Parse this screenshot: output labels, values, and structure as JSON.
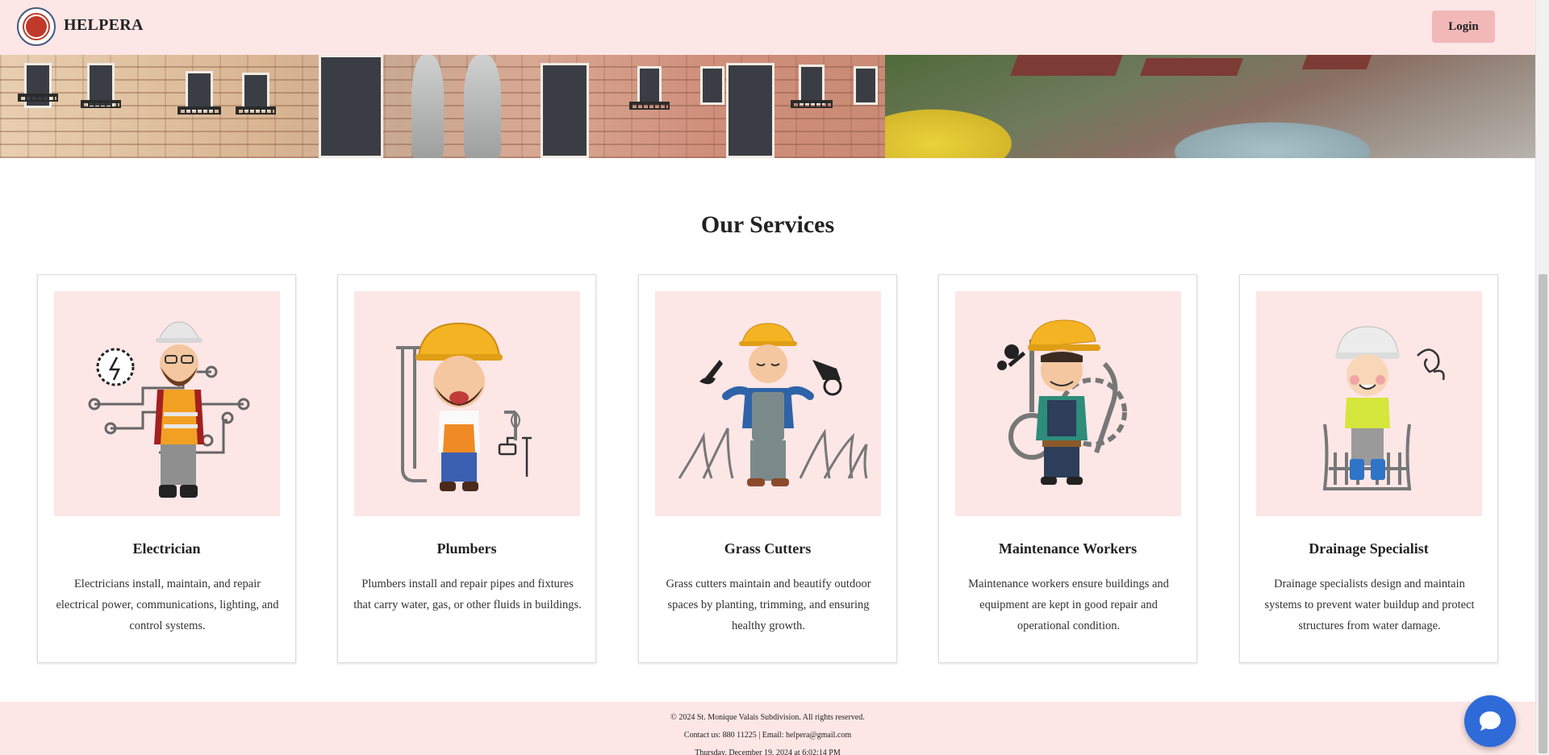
{
  "header": {
    "brand": "HELPERA",
    "login_label": "Login"
  },
  "services": {
    "title": "Our Services",
    "items": [
      {
        "title": "Electrician",
        "description": "Electricians install, maintain, and repair electrical power, communications, lighting, and control systems.",
        "icon": "electrician-worker-icon"
      },
      {
        "title": "Plumbers",
        "description": "Plumbers install and repair pipes and fixtures that carry water, gas, or other fluids in buildings.",
        "icon": "plumber-worker-icon"
      },
      {
        "title": "Grass Cutters",
        "description": "Grass cutters maintain and beautify outdoor spaces by planting, trimming, and ensuring healthy growth.",
        "icon": "grass-cutter-worker-icon"
      },
      {
        "title": "Maintenance Workers",
        "description": "Maintenance workers ensure buildings and equipment are kept in good repair and operational condition.",
        "icon": "maintenance-worker-icon"
      },
      {
        "title": "Drainage Specialist",
        "description": "Drainage specialists design and maintain systems to prevent water buildup and protect structures from water damage.",
        "icon": "drainage-specialist-worker-icon"
      }
    ]
  },
  "footer": {
    "copyright": "© 2024 St. Monique Valais Subdivision. All rights reserved.",
    "contact": "Contact us: 880 11225 | Email: helpera@gmail.com",
    "datetime": "Thursday, December 19, 2024 at 6:02:14 PM"
  },
  "colors": {
    "header_bg": "#fde6e6",
    "login_bg": "#f2b8b8",
    "card_img_bg": "#fde6e6",
    "chat_button": "#2f6ad9"
  }
}
